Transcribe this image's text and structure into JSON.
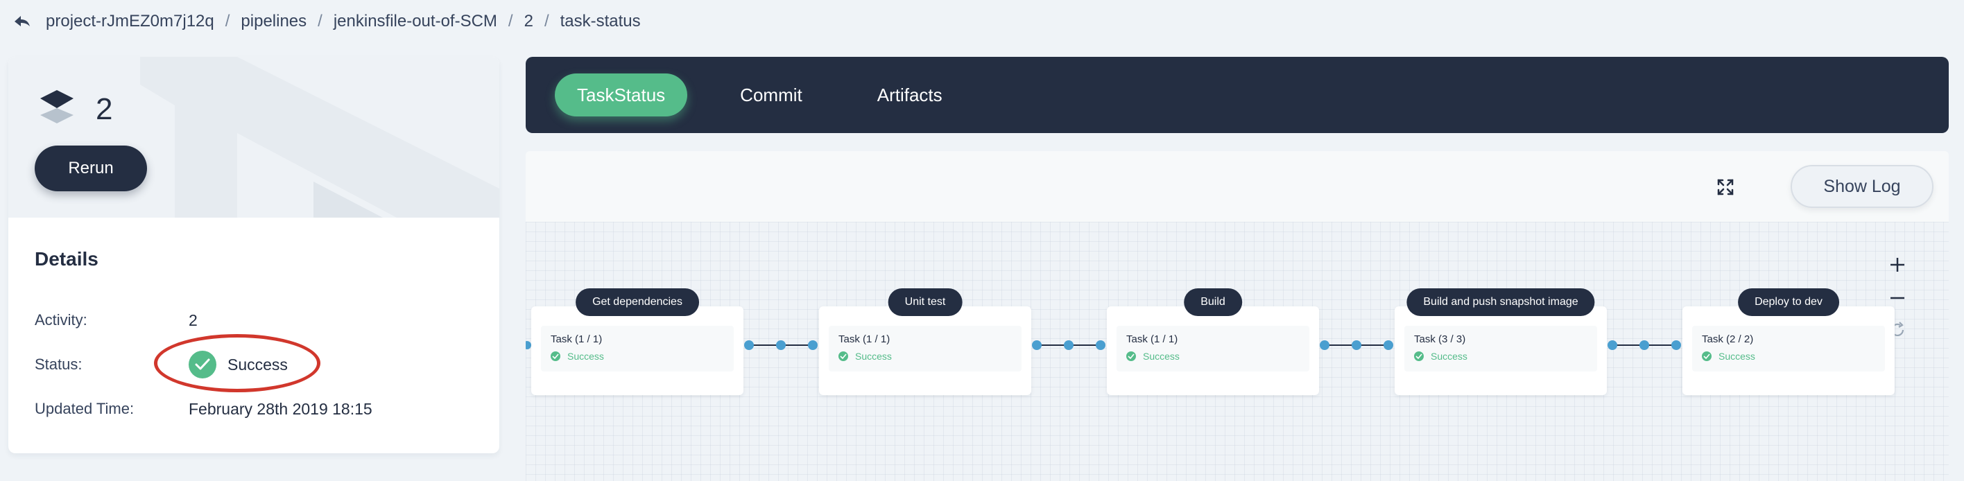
{
  "breadcrumb": {
    "items": [
      "project-rJmEZ0m7j12q",
      "pipelines",
      "jenkinsfile-out-of-SCM",
      "2",
      "task-status"
    ],
    "separator": "/"
  },
  "run": {
    "number": "2",
    "rerun_label": "Rerun"
  },
  "details": {
    "title": "Details",
    "activity_label": "Activity:",
    "activity_value": "2",
    "status_label": "Status:",
    "status_value": "Success",
    "updated_label": "Updated Time:",
    "updated_value": "February 28th 2019 18:15"
  },
  "tabs": [
    {
      "label": "TaskStatus",
      "active": true
    },
    {
      "label": "Commit",
      "active": false
    },
    {
      "label": "Artifacts",
      "active": false
    }
  ],
  "pipeline": {
    "show_log_label": "Show Log",
    "stages": [
      {
        "name": "Get dependencies",
        "task": "Task (1 / 1)",
        "status": "Success"
      },
      {
        "name": "Unit test",
        "task": "Task (1 / 1)",
        "status": "Success"
      },
      {
        "name": "Build",
        "task": "Task (1 / 1)",
        "status": "Success"
      },
      {
        "name": "Build and push snapshot image",
        "task": "Task (3 / 3)",
        "status": "Success"
      },
      {
        "name": "Deploy to dev",
        "task": "Task (2 / 2)",
        "status": "Success"
      }
    ]
  },
  "colors": {
    "dark": "#242e42",
    "success": "#55bc8a",
    "highlight_ring": "#d1372c",
    "connector": "#4a9fd0"
  },
  "icons": {
    "back": "back-arrow-icon",
    "layers": "layers-icon",
    "check": "check-icon",
    "fullscreen": "fullscreen-icon",
    "zoom_in": "plus-icon",
    "zoom_out": "minus-icon",
    "reset": "refresh-icon"
  }
}
